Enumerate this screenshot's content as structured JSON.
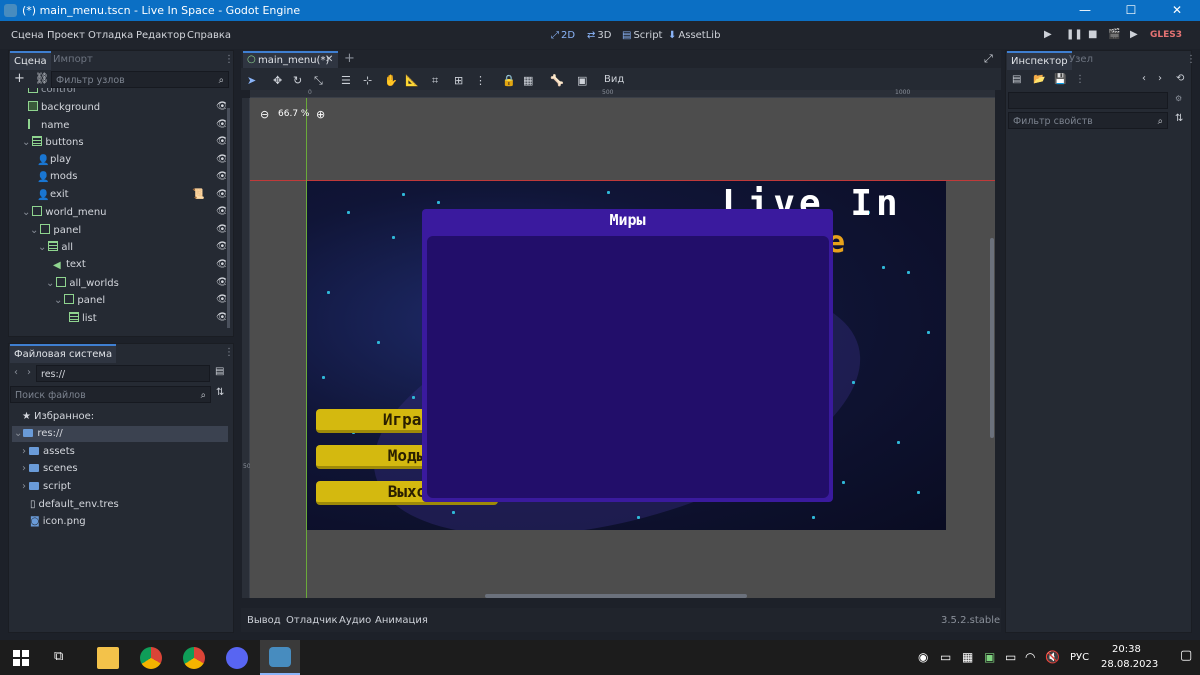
{
  "window": {
    "title": "(*) main_menu.tscn - Live In Space - Godot Engine",
    "minimize": "—",
    "maximize": "☐",
    "close": "✕"
  },
  "menu": [
    "Сцена",
    "Проект",
    "Отладка",
    "Редактор",
    "Справка"
  ],
  "workspaces": [
    {
      "icon": "⤢",
      "label": "2D"
    },
    {
      "icon": "⇄",
      "label": "3D"
    },
    {
      "icon": "▤",
      "label": "Script"
    },
    {
      "icon": "⬇",
      "label": "AssetLib"
    }
  ],
  "run_controls": [
    "▶",
    "❚❚",
    "■",
    "🎬",
    "▶",
    "▶"
  ],
  "renderer": "GLES3",
  "scene_dock": {
    "tabs": [
      "Сцена",
      "Импорт"
    ],
    "filter_placeholder": "Фильтр узлов",
    "nodes": [
      {
        "label": "control",
        "icon": "control-icon"
      },
      {
        "label": "background",
        "icon": "texture-rect-icon"
      },
      {
        "label": "name",
        "icon": "label-icon"
      },
      {
        "label": "buttons",
        "icon": "vbox-icon"
      },
      {
        "label": "play",
        "icon": "button-icon"
      },
      {
        "label": "mods",
        "icon": "button-icon"
      },
      {
        "label": "exit",
        "icon": "button-icon"
      },
      {
        "label": "world_menu",
        "icon": "control-icon"
      },
      {
        "label": "panel",
        "icon": "panel-icon"
      },
      {
        "label": "all",
        "icon": "vbox-icon"
      },
      {
        "label": "text",
        "icon": "label-icon"
      },
      {
        "label": "all_worlds",
        "icon": "scroll-icon"
      },
      {
        "label": "panel",
        "icon": "panel-icon"
      },
      {
        "label": "list",
        "icon": "vbox-icon"
      }
    ]
  },
  "filesystem_dock": {
    "title": "Файловая система",
    "path": "res://",
    "search_placeholder": "Поиск файлов",
    "favorites": "Избранное:",
    "items": [
      {
        "label": "res://",
        "type": "folder"
      },
      {
        "label": "assets",
        "type": "folder"
      },
      {
        "label": "scenes",
        "type": "folder"
      },
      {
        "label": "script",
        "type": "folder"
      },
      {
        "label": "default_env.tres",
        "type": "file"
      },
      {
        "label": "icon.png",
        "type": "image"
      }
    ]
  },
  "editor_tab": {
    "label": "main_menu(*)",
    "close": "✕",
    "add": "+"
  },
  "viewport": {
    "zoom": "66.7 %",
    "view_menu": "Вид",
    "ruler_marks": [
      "0",
      "500",
      "1000"
    ],
    "ruler_v_mark": "500"
  },
  "game": {
    "title_line1": "Live In",
    "title_line2_partial": "e",
    "buttons": [
      "Играт",
      "Моды",
      "Выхо"
    ],
    "world_menu_title": "Миры"
  },
  "inspector": {
    "tabs": [
      "Инспектор",
      "Узел"
    ],
    "filter_placeholder": "Фильтр свойств"
  },
  "bottom_panel": {
    "tabs": [
      "Вывод",
      "Отладчик",
      "Аудио",
      "Анимация"
    ],
    "version": "3.5.2.stable"
  },
  "taskbar": {
    "lang": "РУС",
    "time": "20:38",
    "date": "28.08.2023"
  },
  "colors": {
    "titlebar": "#0b6fc4",
    "accent": "#8ab4f8",
    "modal": "#3a1a9e",
    "button_yellow": "#d4b90f"
  }
}
